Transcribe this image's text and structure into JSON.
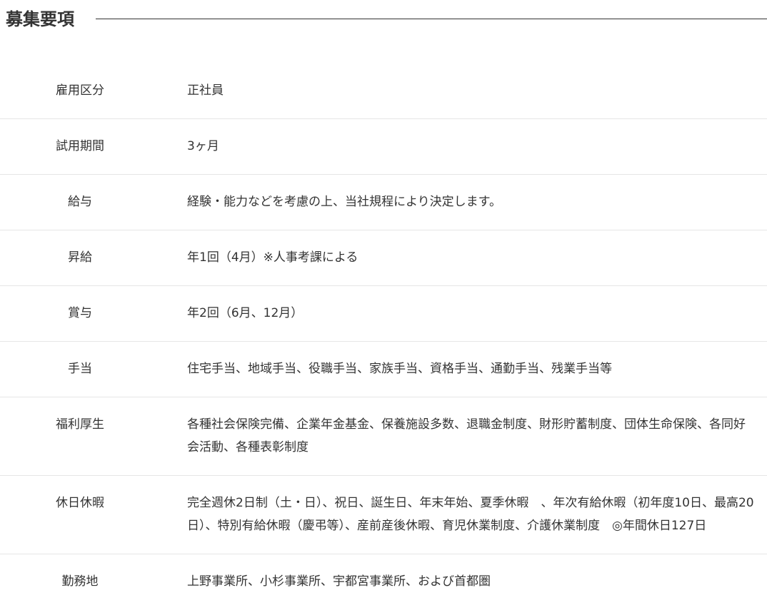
{
  "heading": {
    "title": "募集要項"
  },
  "rows": [
    {
      "label": "雇用区分",
      "value": "正社員"
    },
    {
      "label": "試用期間",
      "value": "3ヶ月"
    },
    {
      "label": "給与",
      "value": "経験・能力などを考慮の上、当社規程により決定します。"
    },
    {
      "label": "昇給",
      "value": "年1回（4月）※人事考課による"
    },
    {
      "label": "賞与",
      "value": "年2回（6月、12月）"
    },
    {
      "label": "手当",
      "value": "住宅手当、地域手当、役職手当、家族手当、資格手当、通勤手当、残業手当等"
    },
    {
      "label": "福利厚生",
      "value": "各種社会保険完備、企業年金基金、保養施設多数、退職金制度、財形貯蓄制度、団体生命保険、各同好会活動、各種表彰制度"
    },
    {
      "label": "休日休暇",
      "value": "完全週休2日制（土・日）、祝日、誕生日、年末年始、夏季休暇　、年次有給休暇（初年度10日、最高20日）、特別有給休暇（慶弔等）、産前産後休暇、育児休業制度、介護休業制度　◎年間休日127日"
    },
    {
      "label": "勤務地",
      "value": "上野事業所、小杉事業所、宇都宮事業所、および首都圏"
    }
  ]
}
